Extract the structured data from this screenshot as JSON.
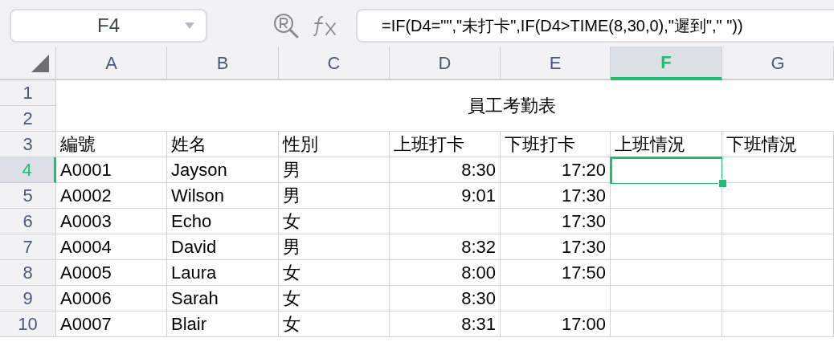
{
  "name_box": {
    "value": "F4"
  },
  "formula_bar": {
    "value": "=IF(D4=\"\",\"未打卡\",IF(D4>TIME(8,30,0),\"遲到\",\" \"))"
  },
  "columns": [
    {
      "label": "A",
      "selected": false
    },
    {
      "label": "B",
      "selected": false
    },
    {
      "label": "C",
      "selected": false
    },
    {
      "label": "D",
      "selected": false
    },
    {
      "label": "E",
      "selected": false
    },
    {
      "label": "F",
      "selected": true
    },
    {
      "label": "G",
      "selected": false
    }
  ],
  "title": {
    "text": "員工考勤表"
  },
  "title_rows": [
    {
      "label": "1",
      "selected": false
    },
    {
      "label": "2",
      "selected": false
    }
  ],
  "rows": [
    {
      "label": "3",
      "selected": false,
      "cells": [
        {
          "kind": "cjk",
          "text": "編號"
        },
        {
          "kind": "cjk",
          "text": "姓名"
        },
        {
          "kind": "cjk",
          "text": "性別"
        },
        {
          "kind": "cjk",
          "text": "上班打卡"
        },
        {
          "kind": "cjk",
          "text": "下班打卡"
        },
        {
          "kind": "cjk",
          "text": "上班情況"
        },
        {
          "kind": "cjk",
          "text": "下班情況"
        }
      ]
    },
    {
      "label": "4",
      "selected": true,
      "cells": [
        {
          "kind": "text",
          "text": "A0001"
        },
        {
          "kind": "text",
          "text": "Jayson"
        },
        {
          "kind": "cjk",
          "text": "男"
        },
        {
          "kind": "time",
          "text": "8:30"
        },
        {
          "kind": "time",
          "text": "17:20"
        },
        {
          "kind": "empty"
        },
        {
          "kind": "empty"
        }
      ]
    },
    {
      "label": "5",
      "selected": false,
      "cells": [
        {
          "kind": "text",
          "text": "A0002"
        },
        {
          "kind": "text",
          "text": "Wilson"
        },
        {
          "kind": "cjk",
          "text": "男"
        },
        {
          "kind": "time",
          "text": "9:01"
        },
        {
          "kind": "time",
          "text": "17:30"
        },
        {
          "kind": "empty"
        },
        {
          "kind": "empty"
        }
      ]
    },
    {
      "label": "6",
      "selected": false,
      "cells": [
        {
          "kind": "text",
          "text": "A0003"
        },
        {
          "kind": "text",
          "text": "Echo"
        },
        {
          "kind": "cjk",
          "text": "女"
        },
        {
          "kind": "empty"
        },
        {
          "kind": "time",
          "text": "17:30"
        },
        {
          "kind": "empty"
        },
        {
          "kind": "empty"
        }
      ]
    },
    {
      "label": "7",
      "selected": false,
      "cells": [
        {
          "kind": "text",
          "text": "A0004"
        },
        {
          "kind": "text",
          "text": "David"
        },
        {
          "kind": "cjk",
          "text": "男"
        },
        {
          "kind": "time",
          "text": "8:32"
        },
        {
          "kind": "time",
          "text": "17:30"
        },
        {
          "kind": "empty"
        },
        {
          "kind": "empty"
        }
      ]
    },
    {
      "label": "8",
      "selected": false,
      "cells": [
        {
          "kind": "text",
          "text": "A0005"
        },
        {
          "kind": "text",
          "text": "Laura"
        },
        {
          "kind": "cjk",
          "text": "女"
        },
        {
          "kind": "time",
          "text": "8:00"
        },
        {
          "kind": "time",
          "text": "17:50"
        },
        {
          "kind": "empty"
        },
        {
          "kind": "empty"
        }
      ]
    },
    {
      "label": "9",
      "selected": false,
      "cells": [
        {
          "kind": "text",
          "text": "A0006"
        },
        {
          "kind": "text",
          "text": "Sarah"
        },
        {
          "kind": "cjk",
          "text": "女"
        },
        {
          "kind": "time",
          "text": "8:30"
        },
        {
          "kind": "empty"
        },
        {
          "kind": "empty"
        },
        {
          "kind": "empty"
        }
      ]
    },
    {
      "label": "10",
      "selected": false,
      "cells": [
        {
          "kind": "text",
          "text": "A0007"
        },
        {
          "kind": "text",
          "text": "Blair"
        },
        {
          "kind": "cjk",
          "text": "女"
        },
        {
          "kind": "time",
          "text": "8:31"
        },
        {
          "kind": "time",
          "text": "17:00"
        },
        {
          "kind": "empty"
        },
        {
          "kind": "empty"
        }
      ]
    }
  ]
}
